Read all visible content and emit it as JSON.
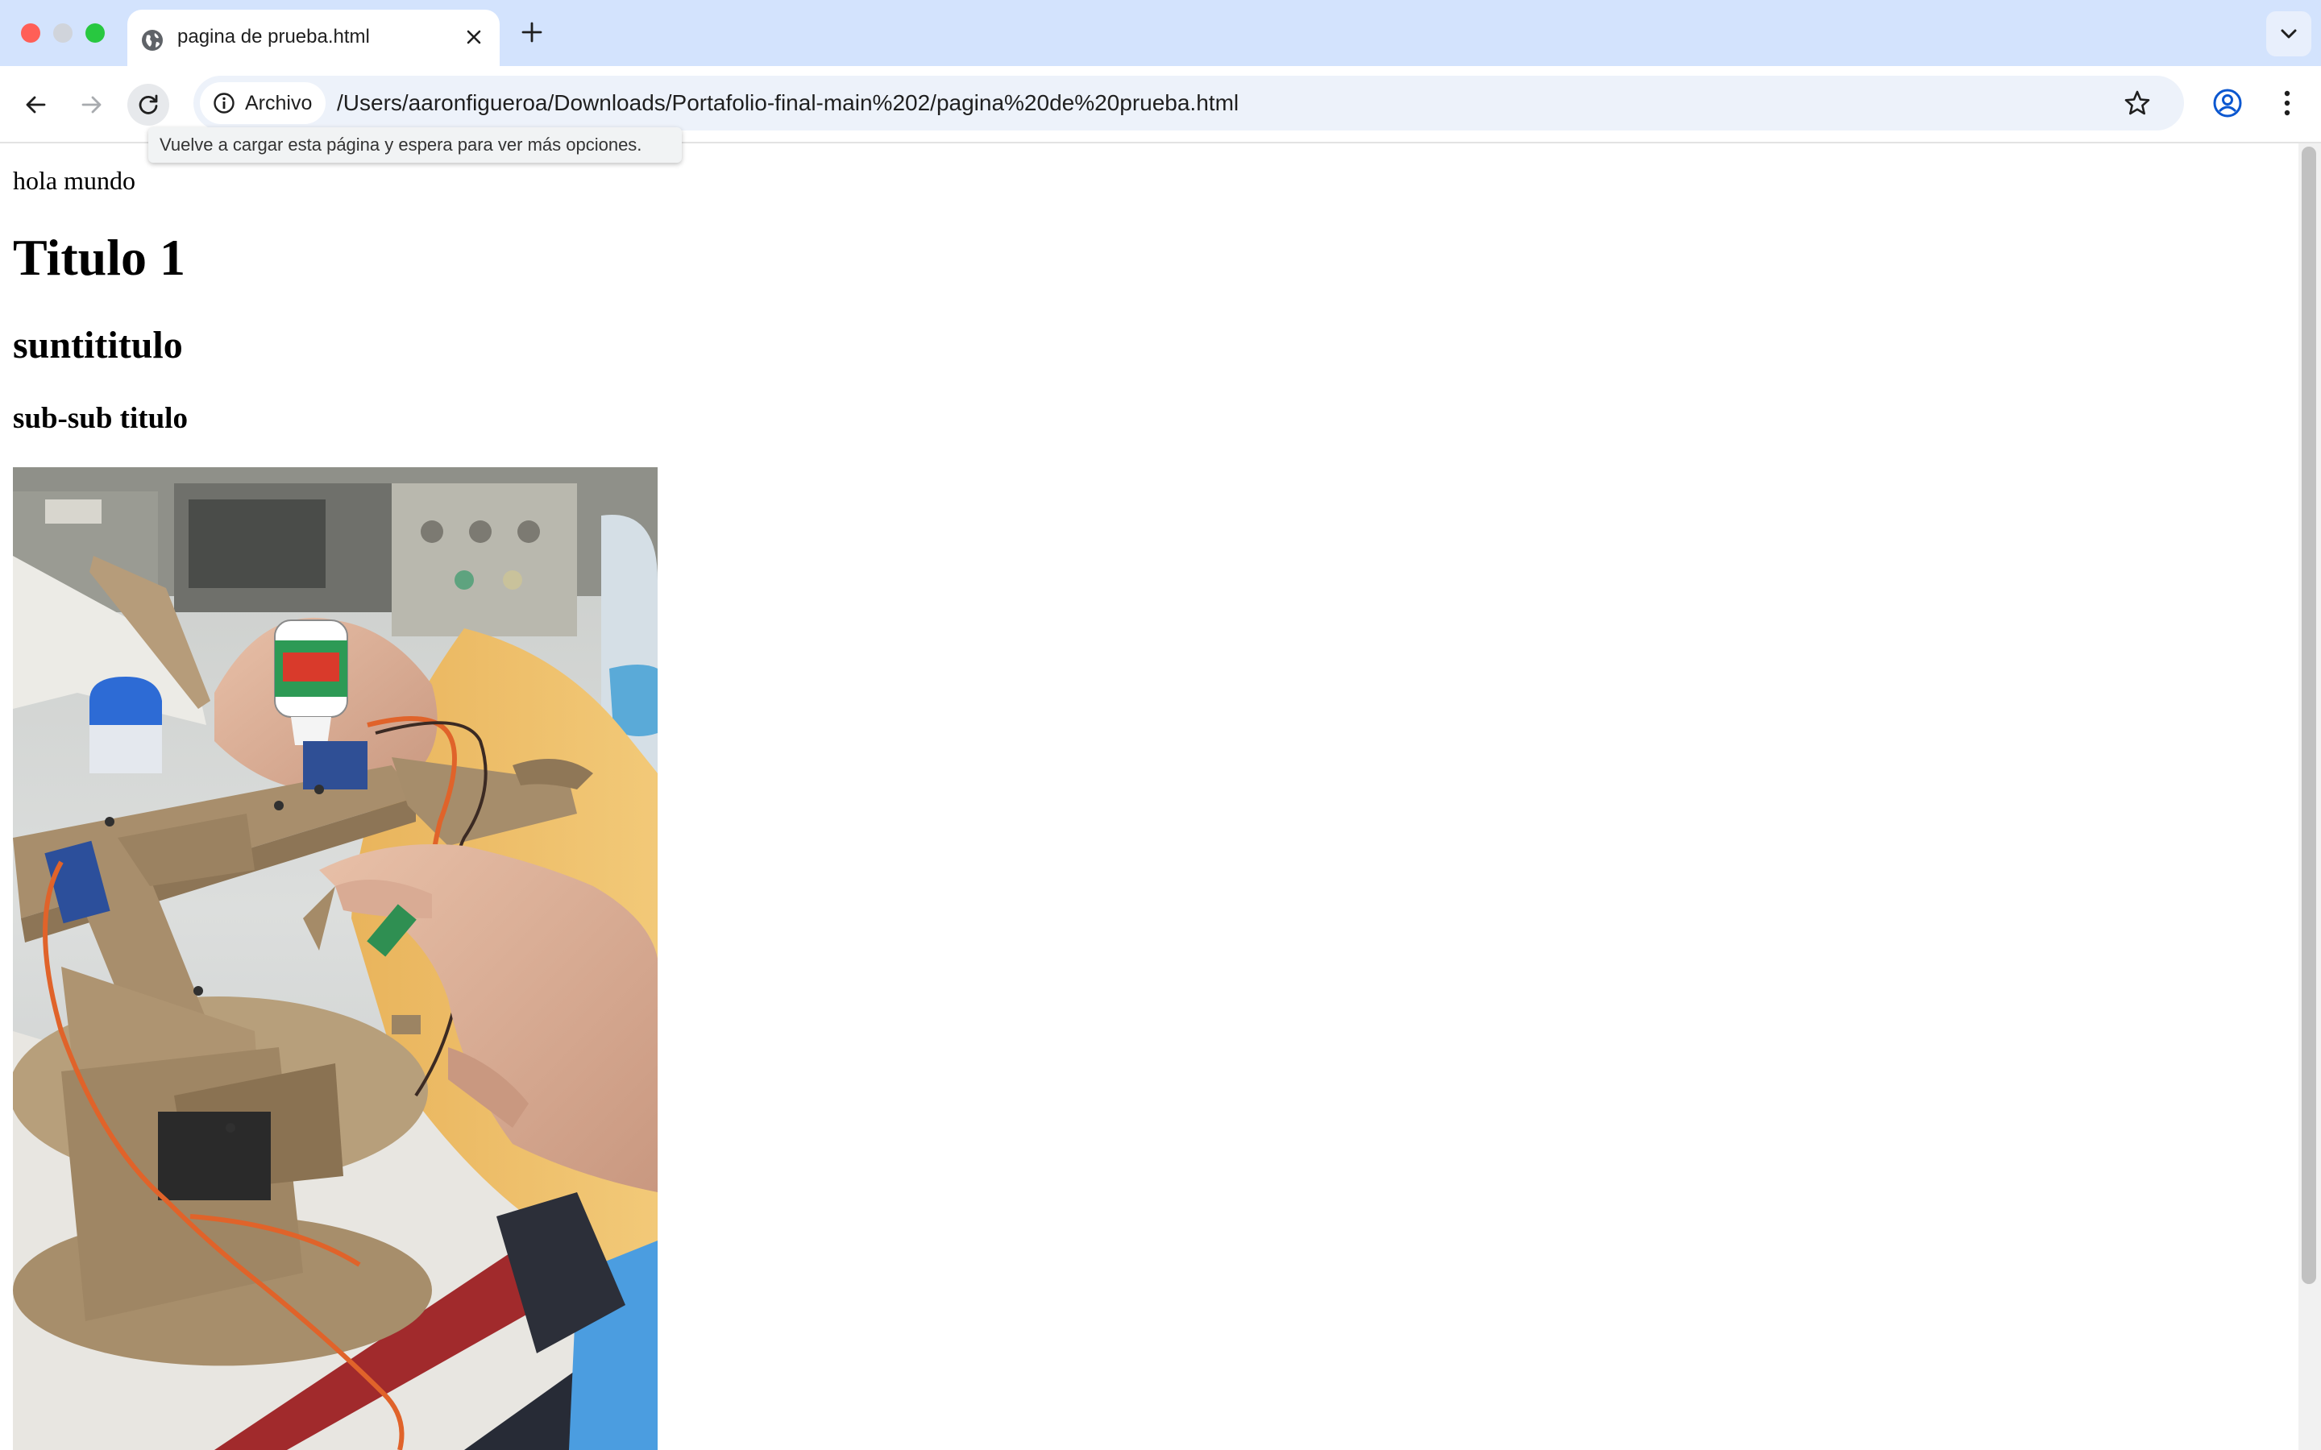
{
  "window": {
    "tab": {
      "title": "pagina de prueba.html"
    },
    "address_bar": {
      "chip_label": "Archivo",
      "url": "/Users/aaronfigueroa/Downloads/Portafolio-final-main%202/pagina%20de%20prueba.html"
    },
    "tooltip": "Vuelve a cargar esta página y espera para ver más opciones."
  },
  "page": {
    "paragraph": "hola mundo",
    "heading1": "Titulo 1",
    "heading2": "suntititulo",
    "heading3": "sub-sub titulo"
  },
  "icons": {
    "tab": "globe-icon",
    "tab_close": "close-icon",
    "new_tab": "plus-icon",
    "tab_search": "chevron-down-icon",
    "back": "arrow-left-icon",
    "forward": "arrow-right-icon",
    "reload": "reload-icon",
    "site_info": "info-icon",
    "bookmark": "star-icon",
    "profile": "profile-icon",
    "menu": "kebab-menu-icon"
  },
  "colors": {
    "tabstrip": "#d3e3fd",
    "omnibox": "#edf2fa",
    "close_button": "#ff5f57",
    "zoom_button": "#28c840",
    "profile_icon": "#0b57d0"
  }
}
